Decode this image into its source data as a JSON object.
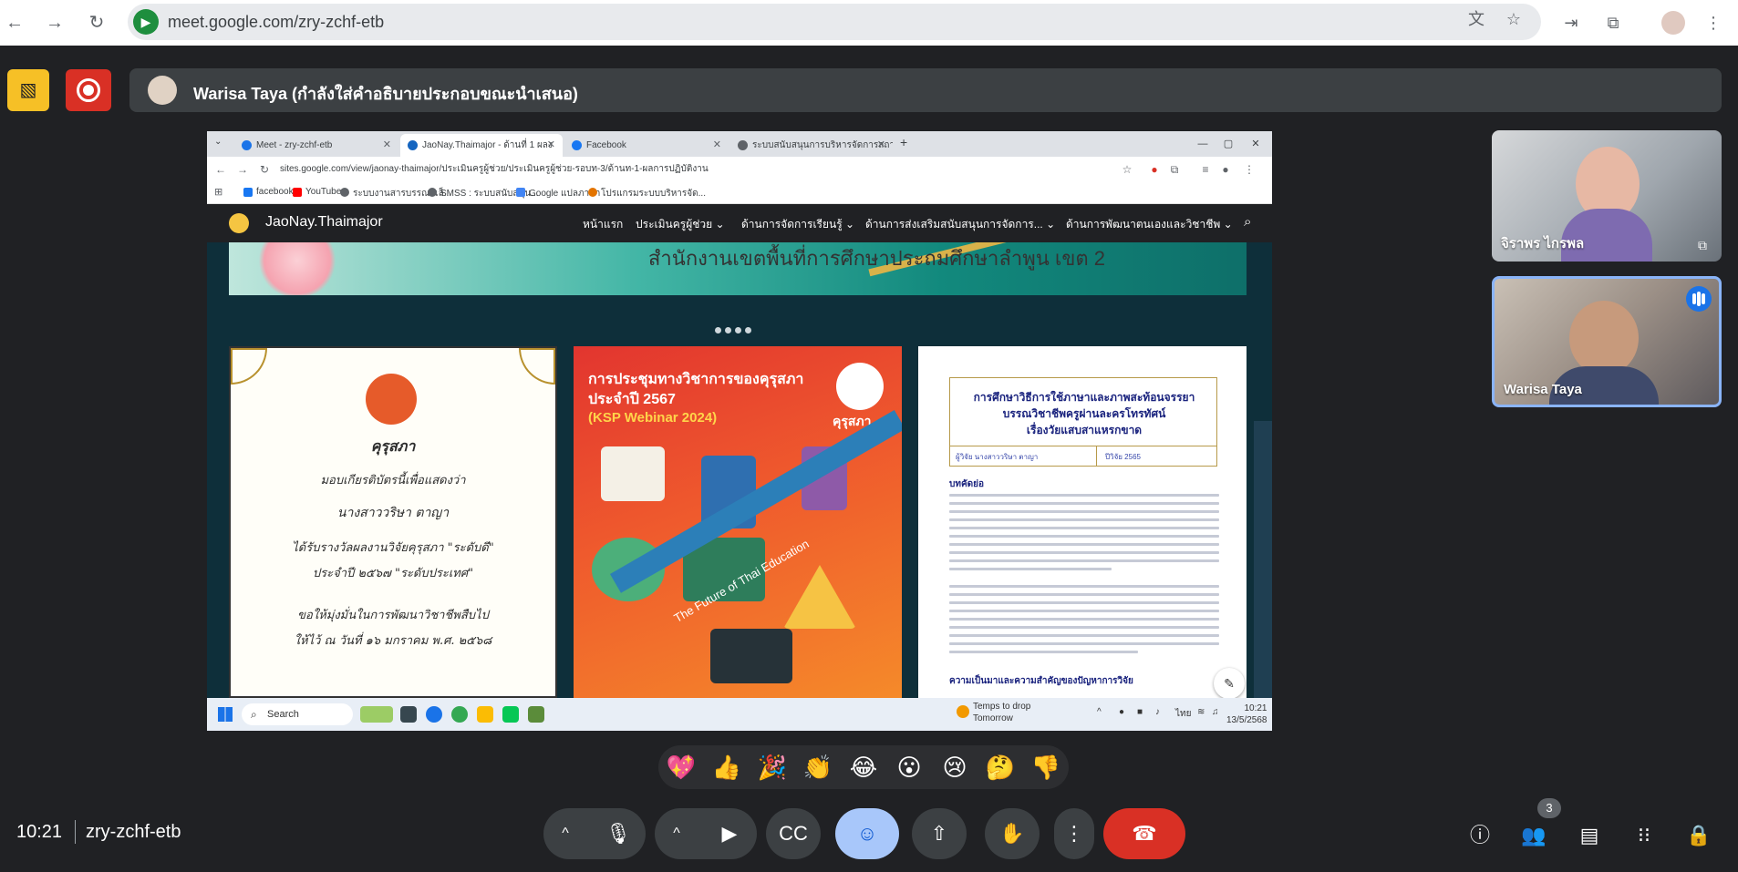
{
  "browser": {
    "url": "meet.google.com/zry-zchf-etb"
  },
  "meet": {
    "presenter_label": "Warisa Taya (กำลังใส่คำอธิบายประกอบขณะนำเสนอ)",
    "meeting_time": "10:21",
    "meeting_code": "zry-zchf-etb",
    "participants_count": "3",
    "participants": [
      {
        "name": "จิราพร ไกรพล"
      },
      {
        "name": "Warisa Taya"
      }
    ],
    "reactions": [
      "💖",
      "👍",
      "🎉",
      "👏",
      "😂",
      "😮",
      "😢",
      "🤔",
      "👎"
    ]
  },
  "shared": {
    "tabs": [
      {
        "label": "Meet - zry-zchf-etb",
        "color": "#1a73e8"
      },
      {
        "label": "JaoNay.Thaimajor - ด้านที่ 1 ผลง",
        "color": "#1565c0"
      },
      {
        "label": "Facebook",
        "color": "#1877f2"
      },
      {
        "label": "ระบบสนับสนุนการบริหารจัดการสถา",
        "color": "#5f6368"
      }
    ],
    "url": "sites.google.com/view/jaonay-thaimajor/ประเมินครูผู้ช่วย/ประเมินครูผู้ช่วย-รอบท-3/ด้านท-1-ผลการปฏิบัติงาน",
    "bookmarks": [
      {
        "label": "facebook",
        "color": "#1877f2"
      },
      {
        "label": "YouTube",
        "color": "#ff0000"
      },
      {
        "label": "ระบบงานสารบรรณอิเล็...",
        "color": "#5f6368"
      },
      {
        "label": "SMSS : ระบบสนับสนุน...",
        "color": "#5f6368"
      },
      {
        "label": "Google แปลภาษา",
        "color": "#4285f4"
      },
      {
        "label": "โปรแกรมระบบบริหารจัด...",
        "color": "#e37400"
      }
    ],
    "site_title": "JaoNay.Thaimajor",
    "nav": [
      "หน้าแรก",
      "ประเมินครูผู้ช่วย",
      "ด้านการจัดการเรียนรู้",
      "ด้านการส่งเสริมสนับสนุนการจัดการ...",
      "ด้านการพัฒนาตนเองและวิชาชีพ"
    ],
    "banner_text": "สำนักงานเขตพื้นที่การศึกษาประถมศึกษาลำพูน เขต 2",
    "cert": {
      "org": "คุรุสภา",
      "line1": "มอบเกียรติบัตรนี้เพื่อแสดงว่า",
      "name": "นางสาววริษา ตาญา",
      "line2": "ได้รับรางวัลผลงานวิจัยคุรุสภา \"ระดับดี\"",
      "line3": "ประจำปี ๒๕๖๗ \"ระดับประเทศ\"",
      "line4": "ขอให้มุ่งมั่นในการพัฒนาวิชาชีพสืบไป",
      "line5": "ให้ไว้ ณ วันที่ ๑๖ มกราคม พ.ศ. ๒๕๖๘"
    },
    "ksp": {
      "title1": "การประชุมทางวิชาการของคุรุสภา",
      "title2": "ประจำปี 2567",
      "title3": "(KSP Webinar 2024)",
      "brand": "คุรุสภา",
      "band": "The Future of Thai Education"
    },
    "paper": {
      "title1": "การศึกษาวิธีการใช้ภาษาและภาพสะท้อนจรรยา",
      "title2": "บรรณวิชาชีพครูผ่านละครโทรทัศน์",
      "title3": "เรื่องวัยแสบสาแหรกขาด",
      "author": "ผู้วิจัย นางสาววริษา ตาญา",
      "year": "ปีวิจัย 2565",
      "abstract_head": "บทคัดย่อ",
      "section_head": "ความเป็นมาและความสำคัญของปัญหาการวิจัย"
    },
    "taskbar": {
      "search": "Search",
      "weather_line1": "Temps to drop",
      "weather_line2": "Tomorrow",
      "lang": "ไทย",
      "time": "10:21",
      "date": "13/5/2568"
    }
  }
}
